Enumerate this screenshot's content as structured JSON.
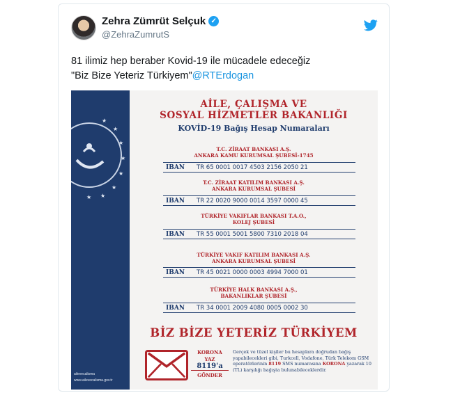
{
  "tweet": {
    "author_name": "Zehra Zümrüt Selçuk",
    "author_handle": "@ZehraZumrutS",
    "verified_mark": "✓",
    "text_line1": "81 ilimiz hep beraber Kovid-19 ile mücadele edeceğiz",
    "text_line2_quote": "\"Biz Bize Yeteriz Türkiyem\"",
    "mention": "@RTErdogan",
    "icons": [
      "avatar",
      "verified-badge-icon",
      "twitter-bird-icon"
    ]
  },
  "poster": {
    "ministry_line1": "AİLE, ÇALIŞMA VE",
    "ministry_line2": "SOSYAL HİZMETLER BAKANLIĞI",
    "subtitle": "KOVİD-19 Bağış Hesap Numaraları",
    "iban_label": "IBAN",
    "banks": [
      {
        "name_line1": "T.C. ZİRAAT BANKASI A.Ş.",
        "name_line2": "ANKARA KAMU KURUMSAL ŞUBESİ-1745",
        "iban": "TR 65 0001 0017 4503 2156 2050 21"
      },
      {
        "name_line1": "T.C. ZİRAAT KATILIM BANKASI A.Ş.",
        "name_line2": "ANKARA KURUMSAL ŞUBESİ",
        "iban": "TR 22 0020 9000 0014 3597 0000 45"
      },
      {
        "name_line1": "TÜRKİYE VAKIFLAR BANKASI T.A.O.,",
        "name_line2": "KOLEJ ŞUBESİ",
        "iban": "TR 55 0001 5001 5800 7310 2018 04"
      },
      {
        "name_line1": "TÜRKİYE VAKIF KATILIM BANKASI A.Ş.",
        "name_line2": "ANKARA KURUMSAL ŞUBESİ",
        "iban": "TR 45 0021 0000 0003 4994 7000 01"
      },
      {
        "name_line1": "TÜRKİYE HALK BANKASI A.Ş.,",
        "name_line2": "BAKANLIKLAR ŞUBESİ",
        "iban": "TR 34 0001 2009 4080 0005 0002 30"
      }
    ],
    "slogan": "BİZ BİZE YETERİZ TÜRKİYEM",
    "sms": {
      "line1": "KORONA",
      "line2": "YAZ",
      "line3": "8119'a",
      "line4": "GÖNDER"
    },
    "sms_description_pre": "Gerçek ve tüzel kişiler bu hesaplara doğrudan bağış yapabilecekleri gibi, Turkcell, Vodafone, Türk Telekom GSM operatörlerinin",
    "sms_number": "8119",
    "sms_description_mid": "SMS numarasına",
    "sms_keyword": "KORONA",
    "sms_description_post": "yazarak 10 (TL) karşılığı bağışta bulunabileceklerdir.",
    "footer_social": "ailevecalisma",
    "footer_url": "www.ailevecalisma.gov.tr",
    "colors": {
      "navy": "#1f3c6d",
      "red": "#b0242a",
      "twitter_blue": "#1da1f2"
    }
  }
}
